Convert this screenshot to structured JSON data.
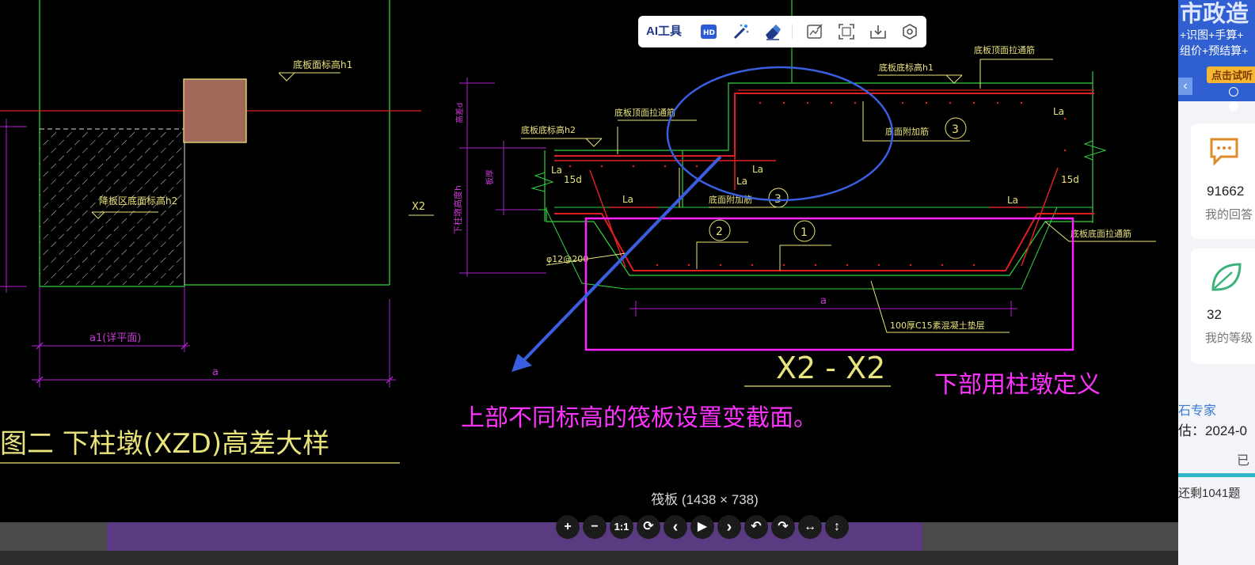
{
  "viewer": {
    "caption": "筏板 (1438 × 738)",
    "controls": [
      "+",
      "−",
      "1:1",
      "⟳",
      "‹",
      "▶",
      "›",
      "↶",
      "↷",
      "↔",
      "↕"
    ]
  },
  "toolbar": {
    "ai_label": "AI工具",
    "hd_label": "HD"
  },
  "drawing": {
    "left_title": "图二  下柱墩(XZD)高差大样",
    "left_labels": {
      "slab_top_h1": "底板面标高h1",
      "pier_bottom_h2": "降板区底面标高h2",
      "a1": "a1(详平面)",
      "a": "a",
      "x2": "X2"
    },
    "section_labels": {
      "top_rebar": "底板顶面拉通筋",
      "bottom_h1": "底板底标高h1",
      "bottom_h2": "底板底标高h2",
      "bottom_add": "底面附加筋",
      "bottom_add_2": "底面附加筋",
      "bottom_through": "底板底面拉通筋",
      "phi": "φ12@200",
      "cushion": "100厚C15素混凝土垫层",
      "section_title": "X2 - X2",
      "a": "a",
      "la": "La",
      "d15": "15d",
      "n1": "1",
      "n2": "2",
      "n3": "3",
      "h_d": "高差d",
      "slab_h": "板厚",
      "pier_h": "下柱墩高度h"
    },
    "annotations": {
      "magenta_right": "下部用柱墩定义",
      "magenta_center": "上部不同标高的筏板设置变截面。"
    }
  },
  "side_panel": {
    "banner_title": "市政造",
    "banner_line1": "+识图+手算+",
    "banner_line2": "组价+预结算+",
    "banner_button": "点击试听",
    "card1_value": "91662",
    "card1_label": "我的回答",
    "card2_value": "32",
    "card2_label": "我的等级",
    "expert": "石专家",
    "date": "估：2024-0",
    "done": "已",
    "remain": "还剩1041题"
  },
  "colors": {
    "cad_bg": "#000000",
    "green": "#2fd23f",
    "red": "#e02020",
    "magenta": "#ff22ff",
    "yellow": "#e8e37a",
    "purple": "#b020d0",
    "blue_annot": "#3a5ee0"
  }
}
